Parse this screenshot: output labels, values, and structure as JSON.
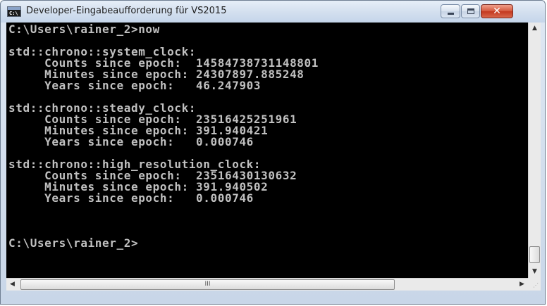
{
  "window": {
    "title": "Developer-Eingabeaufforderung für VS2015",
    "icon": "cmd-icon",
    "icon_text": "C:\\",
    "controls": {
      "minimize_icon": "minimize-icon",
      "maximize_icon": "maximize-icon",
      "close_icon": "close-icon",
      "close_glyph": "✕"
    },
    "accent_close": "#c3381f"
  },
  "console": {
    "background": "#000000",
    "foreground": "#c0c0c0",
    "lines": [
      "C:\\Users\\rainer_2>now",
      "",
      "std::chrono::system_clock:",
      "     Counts since epoch:  14584738731148801",
      "     Minutes since epoch: 24307897.885248",
      "     Years since epoch:   46.247903",
      "",
      "std::chrono::steady_clock:",
      "     Counts since epoch:  23516425251961",
      "     Minutes since epoch: 391.940421",
      "     Years since epoch:   0.000746",
      "",
      "std::chrono::high_resolution_clock:",
      "     Counts since epoch:  23516430130632",
      "     Minutes since epoch: 391.940502",
      "     Years since epoch:   0.000746",
      "",
      "",
      "",
      "C:\\Users\\rainer_2>"
    ]
  },
  "scrollbars": {
    "up_glyph": "▲",
    "down_glyph": "▼",
    "left_glyph": "◀",
    "right_glyph": "▶",
    "hthumb_grip": "III",
    "size_grip": "⋰"
  }
}
